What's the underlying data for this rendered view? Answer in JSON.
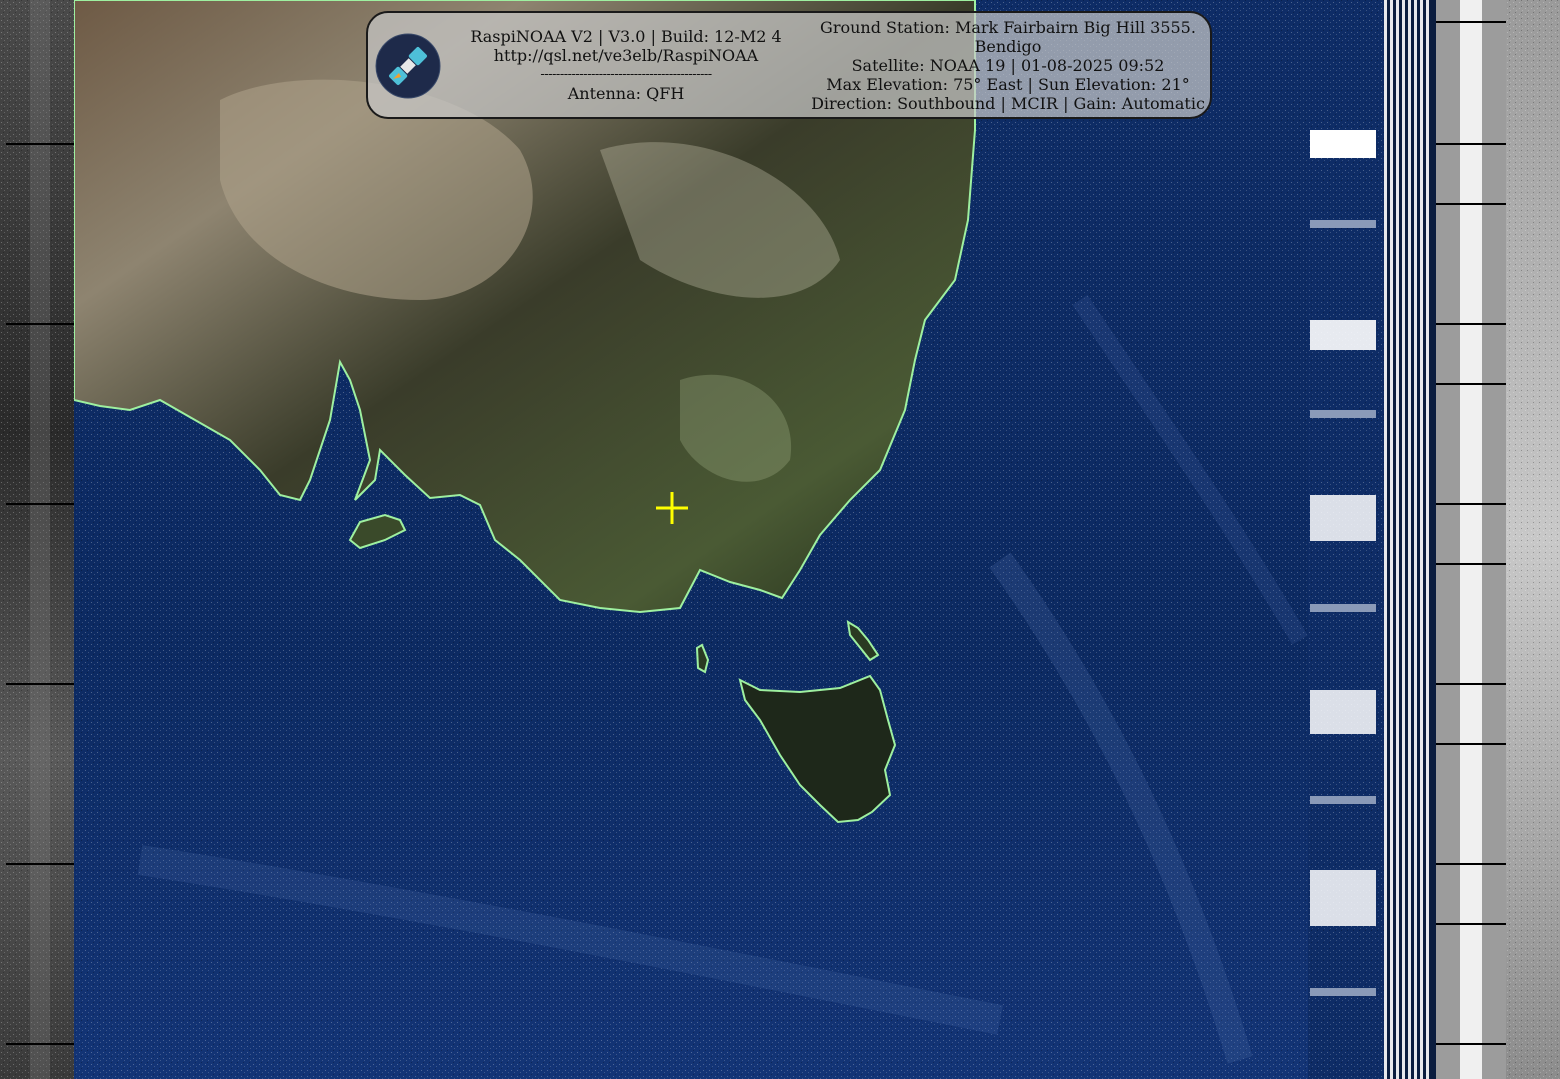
{
  "header": {
    "software_line": "RaspiNOAA V2 | V3.0 | Build: 12-M2 4",
    "url_line": "http://qsl.net/ve3elb/RaspiNOAA",
    "divider_line": "--------------------------------------------",
    "antenna_line": "Antenna: QFH",
    "ground_station_line1": "Ground Station: Mark Fairbairn Big Hill 3555.",
    "ground_station_line2": "Bendigo",
    "satellite_line": "Satellite: NOAA 19 | 01-08-2025 09:52",
    "elevation_line": "Max Elevation: 75° East | Sun Elevation: 21°",
    "direction_line": "Direction: Southbound | MCIR | Gain: Automatic"
  },
  "colors": {
    "ocean": "#0d2a66",
    "land_dark": "#2c3322",
    "land_light": "#8a8060",
    "coastline": "#9ef0a0",
    "marker": "#ffff00",
    "overlay_bg": "#c8c8c8"
  },
  "icons": {
    "logo": "satellite-logo-icon",
    "marker": "crosshair-marker-icon"
  }
}
